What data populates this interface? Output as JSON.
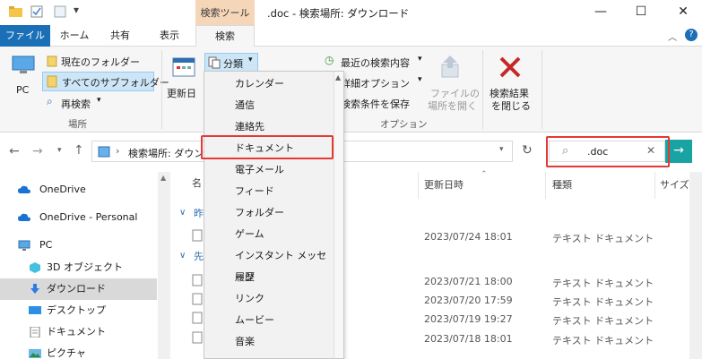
{
  "titlebar": {
    "context_tab": "検索ツール",
    "title": ".doc - 検索場所: ダウンロード",
    "minimize": "—",
    "maximize": "☐",
    "close": "✕"
  },
  "ribbon_tabs": {
    "file": "ファイル",
    "home": "ホーム",
    "share": "共有",
    "view": "表示",
    "search": "検索"
  },
  "ribbon": {
    "pc": "PC",
    "current_folder": "現在のフォルダー",
    "all_subfolders": "すべてのサブフォルダー",
    "search_again": "再検索",
    "location_group": "場所",
    "date_modified": "更新日",
    "kind": "分類",
    "recent_searches": "最近の検索内容",
    "advanced_options": "詳細オプション",
    "save_search": "検索条件を保存",
    "options_group": "オプション",
    "open_location_l1": "ファイルの",
    "open_location_l2": "場所を開く",
    "close_search_l1": "検索結果",
    "close_search_l2": "を閉じる"
  },
  "address": {
    "path": "検索場所: ダウンロード",
    "search_value": ".doc"
  },
  "dropdown": {
    "items": [
      "カレンダー",
      "通信",
      "連絡先",
      "ドキュメント",
      "電子メール",
      "フィード",
      "フォルダー",
      "ゲーム",
      "インスタント メッセージ",
      "履歴",
      "リンク",
      "ムービー",
      "音楽"
    ]
  },
  "nav": {
    "items": [
      {
        "label": "OneDrive",
        "icon": "cloud-icon"
      },
      {
        "label": "OneDrive - Personal",
        "icon": "cloud-icon"
      },
      {
        "label": "PC",
        "icon": "pc-icon"
      },
      {
        "label": "3D オブジェクト",
        "icon": "cube-icon"
      },
      {
        "label": "ダウンロード",
        "icon": "download-icon"
      },
      {
        "label": "デスクトップ",
        "icon": "desktop-icon"
      },
      {
        "label": "ドキュメント",
        "icon": "document-icon"
      },
      {
        "label": "ピクチャ",
        "icon": "pictures-icon"
      }
    ]
  },
  "filelist": {
    "col_name": "名",
    "col_date": "更新日時",
    "col_type": "種類",
    "col_size": "サイズ",
    "group1": "昨",
    "group2": "先",
    "rows": [
      {
        "date": "2023/07/24 18:01",
        "type": "テキスト ドキュメント"
      },
      {
        "date": "2023/07/21 18:00",
        "type": "テキスト ドキュメント"
      },
      {
        "date": "2023/07/20 17:59",
        "type": "テキスト ドキュメント"
      },
      {
        "date": "2023/07/19 19:27",
        "type": "テキスト ドキュメント"
      },
      {
        "date": "2023/07/18 18:01",
        "type": "テキスト ドキュメント"
      }
    ]
  },
  "colors": {
    "file_tab": "#1a6fb7",
    "context_tab": "#f6d6b9",
    "highlight": "#e53935",
    "accent": "#1aa3a3"
  }
}
